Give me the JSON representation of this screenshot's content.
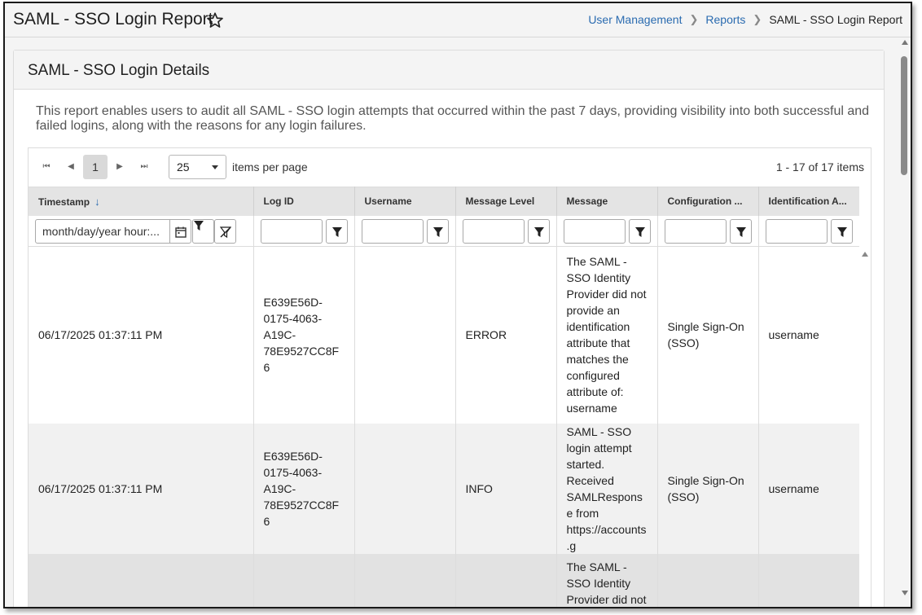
{
  "header": {
    "title": "SAML - SSO Login Report",
    "breadcrumb": [
      "User Management",
      "Reports",
      "SAML - SSO Login Report"
    ]
  },
  "card": {
    "title": "SAML - SSO Login Details",
    "description": "This report enables users to audit all SAML - SSO login attempts that occurred within the past 7 days, providing visibility into both successful and failed logins, along with the reasons for any login failures."
  },
  "pager": {
    "current_page": "1",
    "page_size": "25",
    "per_page_label": "items per page",
    "info": "1 - 17 of 17 items"
  },
  "columns": [
    "Timestamp",
    "Log ID",
    "Username",
    "Message Level",
    "Message",
    "Configuration ...",
    "Identification A..."
  ],
  "filters": {
    "timestamp_placeholder": "month/day/year hour:..."
  },
  "rows": [
    {
      "timestamp": "06/17/2025 01:37:11 PM",
      "log_id": "E639E56D-0175-4063-A19C-78E9527CC8F6",
      "username": "",
      "level": "ERROR",
      "message": "The SAML - SSO Identity Provider did not provide an identification attribute that matches the configured attribute of: username",
      "configuration": "Single Sign-On (SSO)",
      "identification": "username"
    },
    {
      "timestamp": "06/17/2025 01:37:11 PM",
      "log_id": "E639E56D-0175-4063-A19C-78E9527CC8F6",
      "username": "",
      "level": "INFO",
      "message": "SAML - SSO login attempt started. Received SAMLResponse from https://accounts.g",
      "configuration": "Single Sign-On (SSO)",
      "identification": "username"
    },
    {
      "timestamp": "",
      "log_id": "",
      "username": "",
      "level": "",
      "message": "The SAML - SSO Identity Provider did not",
      "configuration": "",
      "identification": ""
    }
  ],
  "colors": {
    "link": "#2a6bb0",
    "header_bg": "#e4e4e4",
    "page_bg": "#f4f4f4"
  }
}
